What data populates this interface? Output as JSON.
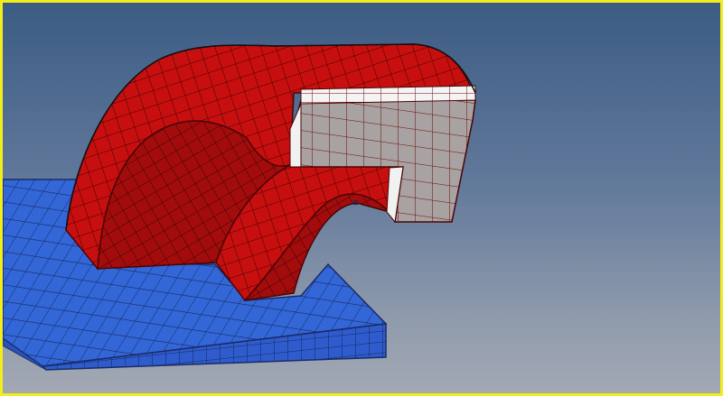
{
  "viewport": {
    "background_top": "#3c5c84",
    "background_bottom": "#a3a9b4",
    "border_color": "#f2ee1c"
  },
  "model": {
    "base_plate": {
      "color": "#3366d6",
      "side_color": "#2f5ccd",
      "edge_color": "#1a2b66"
    },
    "arch": {
      "color": "#c80f0f",
      "inner_color": "#a30c0c",
      "cut_face_color": "#a8a3a2",
      "edge_color": "#4a0505"
    }
  },
  "cursor_marker_icon": "square-node-marker-icon"
}
